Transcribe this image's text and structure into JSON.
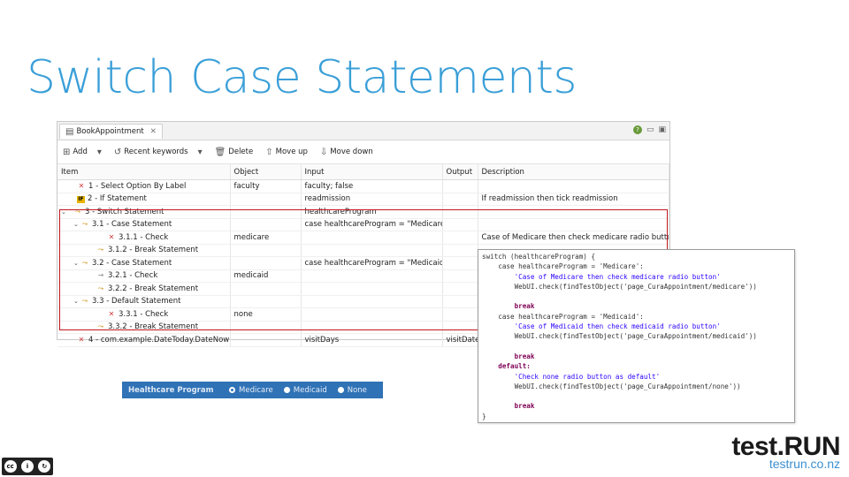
{
  "slide": {
    "title": "Switch Case Statements"
  },
  "editor": {
    "tab_label": "BookAppointment",
    "tab_close": "✕",
    "toolbar": {
      "add": "Add",
      "recent": "Recent keywords",
      "delete": "Delete",
      "move_up": "Move up",
      "move_down": "Move down"
    },
    "columns": [
      "Item",
      "Object",
      "Input",
      "Output",
      "Description"
    ],
    "rows": [
      {
        "item": "1 - Select Option By Label",
        "object": "faculty",
        "input": "faculty; false",
        "output": "",
        "desc": ""
      },
      {
        "item": "2 - If Statement",
        "object": "",
        "input": "readmission",
        "output": "",
        "desc": "If readmission then tick readmission"
      },
      {
        "item": "3 - Switch Statement",
        "object": "",
        "input": "healthcareProgram",
        "output": "",
        "desc": ""
      },
      {
        "item": "3.1 - Case Statement",
        "object": "",
        "input": "case healthcareProgram = \"Medicare\":",
        "output": "",
        "desc": ""
      },
      {
        "item": "3.1.1 - Check",
        "object": "medicare",
        "input": "",
        "output": "",
        "desc": "Case of Medicare then check medicare radio button"
      },
      {
        "item": "3.1.2 - Break Statement",
        "object": "",
        "input": "",
        "output": "",
        "desc": ""
      },
      {
        "item": "3.2 - Case Statement",
        "object": "",
        "input": "case healthcareProgram = \"Medicaid\":",
        "output": "",
        "desc": ""
      },
      {
        "item": "3.2.1 - Check",
        "object": "medicaid",
        "input": "",
        "output": "",
        "desc": ""
      },
      {
        "item": "3.2.2 - Break Statement",
        "object": "",
        "input": "",
        "output": "",
        "desc": ""
      },
      {
        "item": "3.3 - Default Statement",
        "object": "",
        "input": "",
        "output": "",
        "desc": ""
      },
      {
        "item": "3.3.1 - Check",
        "object": "none",
        "input": "",
        "output": "",
        "desc": ""
      },
      {
        "item": "3.3.2 - Break Statement",
        "object": "",
        "input": "",
        "output": "",
        "desc": ""
      },
      {
        "item": "4 - com.example.DateToday.DateNow",
        "object": "",
        "input": "visitDays",
        "output": "visitDate",
        "desc": ""
      }
    ]
  },
  "code": {
    "lines": [
      "switch (healthcareProgram) {",
      "    case healthcareProgram = 'Medicare':",
      "        'Case of Medicare then check medicare radio button'",
      "        WebUI.check(findTestObject('page_CuraAppointment/medicare'))",
      "",
      "        break",
      "    case healthcareProgram = 'Medicaid':",
      "        'Case of Medicaid then check medicaid radio button'",
      "        WebUI.check(findTestObject('page_CuraAppointment/medicaid'))",
      "",
      "        break",
      "    default:",
      "        'Check none radio button as default'",
      "        WebUI.check(findTestObject('page_CuraAppointment/none'))",
      "",
      "        break",
      "}"
    ]
  },
  "radio": {
    "label": "Healthcare Program",
    "options": [
      "Medicare",
      "Medicaid",
      "None"
    ],
    "selected": "Medicare"
  },
  "brand": {
    "main": "test.RUN",
    "sub": "testrun.co.nz"
  },
  "license": {
    "badge": "cc"
  }
}
